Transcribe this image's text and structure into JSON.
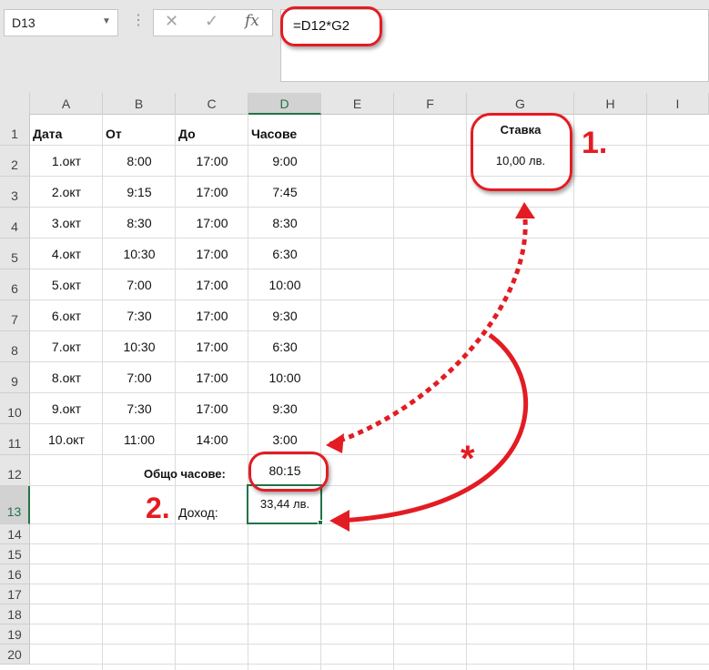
{
  "name_box": "D13",
  "formula": "=D12*G2",
  "fx_label": "fx",
  "cancel_glyph": "✕",
  "enter_glyph": "✓",
  "columns": [
    "A",
    "B",
    "C",
    "D",
    "E",
    "F",
    "G",
    "H",
    "I"
  ],
  "rows": [
    "1",
    "2",
    "3",
    "4",
    "5",
    "6",
    "7",
    "8",
    "9",
    "10",
    "11",
    "12",
    "13",
    "14",
    "15",
    "16",
    "17",
    "18",
    "19",
    "20"
  ],
  "selected_column": "D",
  "selected_row": "13",
  "headers": {
    "date": "Дата",
    "from": "От",
    "to": "До",
    "hours": "Часове"
  },
  "table": [
    {
      "date": "1.окт",
      "from": "8:00",
      "to": "17:00",
      "hours": "9:00"
    },
    {
      "date": "2.окт",
      "from": "9:15",
      "to": "17:00",
      "hours": "7:45"
    },
    {
      "date": "3.окт",
      "from": "8:30",
      "to": "17:00",
      "hours": "8:30"
    },
    {
      "date": "4.окт",
      "from": "10:30",
      "to": "17:00",
      "hours": "6:30"
    },
    {
      "date": "5.окт",
      "from": "7:00",
      "to": "17:00",
      "hours": "10:00"
    },
    {
      "date": "6.окт",
      "from": "7:30",
      "to": "17:00",
      "hours": "9:30"
    },
    {
      "date": "7.окт",
      "from": "10:30",
      "to": "17:00",
      "hours": "6:30"
    },
    {
      "date": "8.окт",
      "from": "7:00",
      "to": "17:00",
      "hours": "10:00"
    },
    {
      "date": "9.окт",
      "from": "7:30",
      "to": "17:00",
      "hours": "9:30"
    },
    {
      "date": "10.окт",
      "from": "11:00",
      "to": "14:00",
      "hours": "3:00"
    }
  ],
  "rate": {
    "label": "Ставка",
    "value": "10,00 лв."
  },
  "total": {
    "label": "Общо часове:",
    "value": "80:15"
  },
  "income": {
    "label": "Доход:",
    "value": "33,44 лв."
  },
  "annotations": {
    "step1": "1.",
    "step2": "2.",
    "multiply": "*"
  },
  "colors": {
    "accent_green": "#217346",
    "annotation_red": "#e31c23"
  }
}
